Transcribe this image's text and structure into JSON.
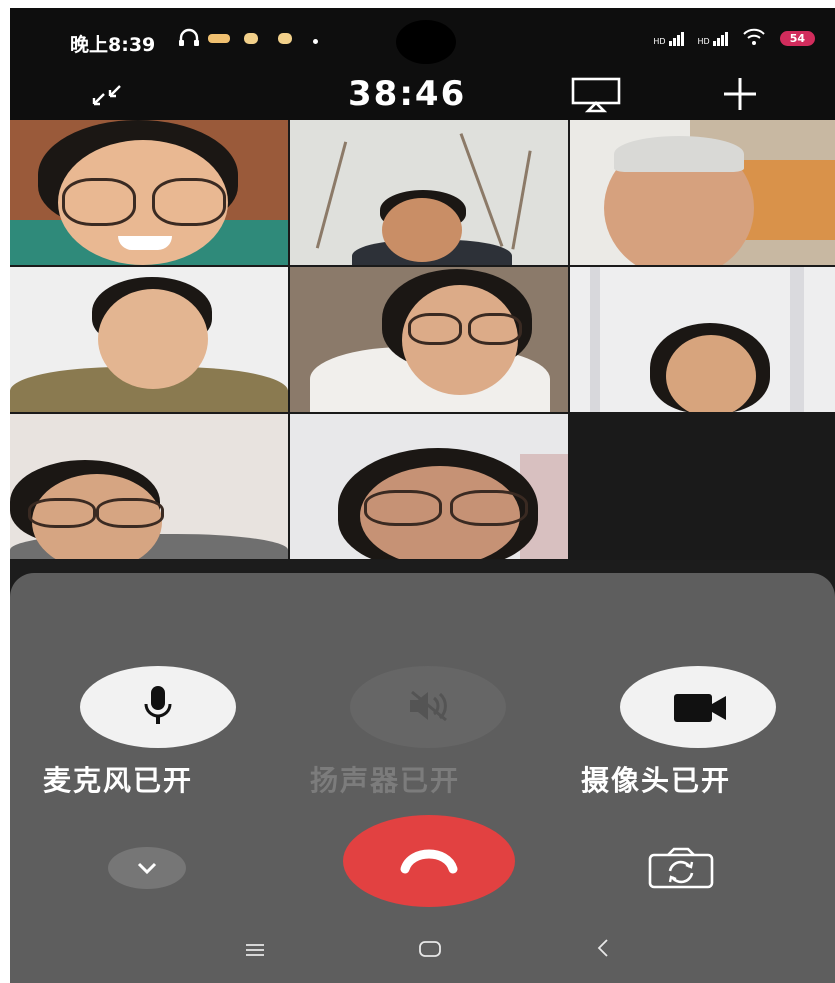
{
  "status_bar": {
    "time": "晚上8:39",
    "signal1": "HD",
    "signal2": "HD",
    "battery": "54"
  },
  "call_header": {
    "timer": "38:46"
  },
  "controls": {
    "mic_label": "麦克风已开",
    "speaker_label": "扬声器已开",
    "camera_label": "摄像头已开"
  },
  "participants_count": 8,
  "colors": {
    "end_call": "#e24141",
    "panel": "#5e5e5e",
    "background": "#1c1c1c"
  }
}
